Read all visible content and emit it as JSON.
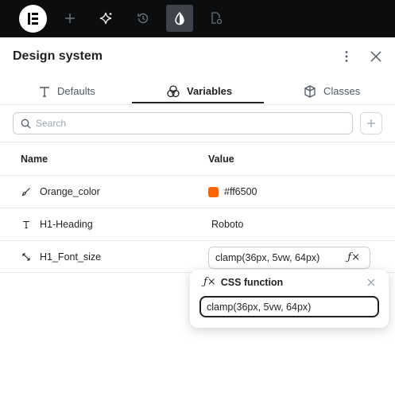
{
  "toolbar": {
    "logo_icon": "elementor-logo-icon",
    "buttons": [
      {
        "icon": "plus-icon"
      },
      {
        "icon": "ai-sparkle-icon"
      },
      {
        "icon": "history-icon"
      },
      {
        "icon": "droplet-icon",
        "active": true
      },
      {
        "icon": "page-settings-icon"
      }
    ]
  },
  "panel": {
    "title": "Design system",
    "more_icon": "more-vertical-icon",
    "close_icon": "close-icon"
  },
  "tabs": [
    {
      "label": "Defaults",
      "icon": "typography-icon"
    },
    {
      "label": "Variables",
      "icon": "color-circles-icon",
      "active": true
    },
    {
      "label": "Classes",
      "icon": "classes-icon"
    }
  ],
  "search": {
    "placeholder": "Search",
    "add_icon": "plus-icon"
  },
  "table": {
    "headers": {
      "name": "Name",
      "value": "Value"
    },
    "rows": [
      {
        "icon": "brush-icon",
        "name": "Orange_color",
        "value": "#ff6500",
        "swatch": "#ff6500"
      },
      {
        "icon": "text-icon",
        "name": "H1-Heading",
        "value": "Roboto"
      },
      {
        "icon": "resize-icon",
        "name": "H1_Font_size",
        "value": "clamp(36px, 5vw, 64px)"
      }
    ]
  },
  "popover": {
    "title": "CSS function",
    "fx_label": "ƒ×",
    "value": "clamp(36px, 5vw, 64px)"
  },
  "colors": {
    "accent": "#ff6500",
    "toolbar_bg": "#0c0d0e",
    "active_btn": "#3f444b"
  }
}
